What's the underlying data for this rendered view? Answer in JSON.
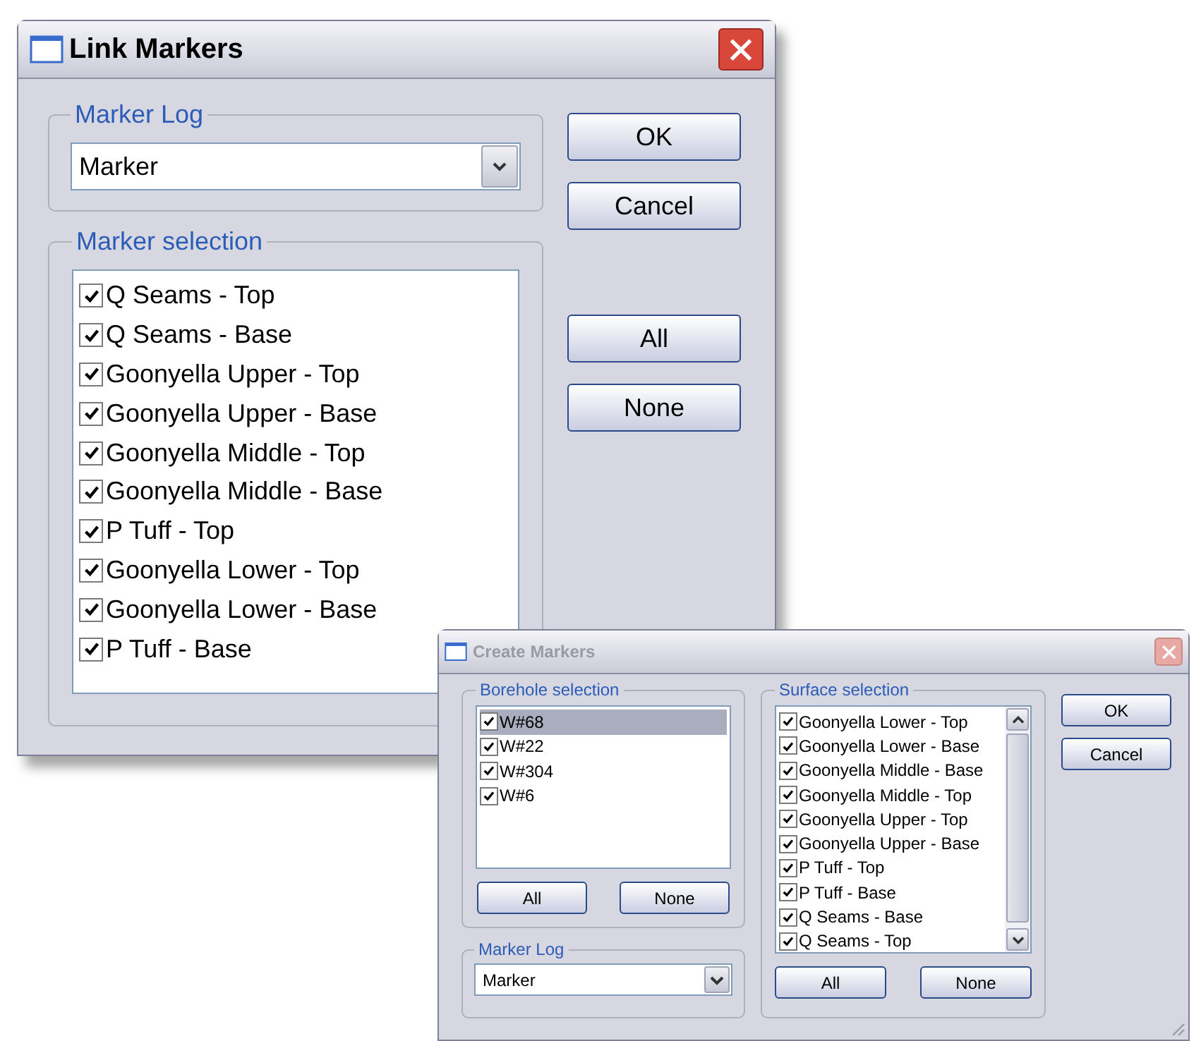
{
  "link_markers": {
    "title": "Link Markers",
    "active": true,
    "marker_log": {
      "label": "Marker Log",
      "value": "Marker"
    },
    "marker_selection": {
      "label": "Marker selection",
      "items": [
        {
          "label": "Q Seams - Top",
          "checked": true
        },
        {
          "label": "Q Seams - Base",
          "checked": true
        },
        {
          "label": "Goonyella Upper - Top",
          "checked": true
        },
        {
          "label": "Goonyella Upper - Base",
          "checked": true
        },
        {
          "label": "Goonyella Middle - Top",
          "checked": true
        },
        {
          "label": "Goonyella Middle - Base",
          "checked": true
        },
        {
          "label": "P Tuff - Top",
          "checked": true
        },
        {
          "label": "Goonyella Lower - Top",
          "checked": true
        },
        {
          "label": "Goonyella Lower - Base",
          "checked": true
        },
        {
          "label": "P Tuff - Base",
          "checked": true
        }
      ]
    },
    "buttons": [
      "OK",
      "Cancel"
    ],
    "selection_buttons": [
      "All",
      "None"
    ]
  },
  "create_markers": {
    "title": "Create Markers",
    "active": false,
    "borehole_selection": {
      "label": "Borehole selection",
      "items": [
        {
          "label": "W#68",
          "checked": true,
          "selected": true
        },
        {
          "label": "W#22",
          "checked": true,
          "selected": false
        },
        {
          "label": "W#304",
          "checked": true,
          "selected": false
        },
        {
          "label": "W#6",
          "checked": true,
          "selected": false
        }
      ],
      "buttons": [
        "All",
        "None"
      ]
    },
    "marker_log": {
      "label": "Marker Log",
      "value": "Marker"
    },
    "surface_selection": {
      "label": "Surface selection",
      "items": [
        {
          "label": "Goonyella Lower - Top",
          "checked": true
        },
        {
          "label": "Goonyella Lower - Base",
          "checked": true
        },
        {
          "label": "Goonyella Middle - Base",
          "checked": true
        },
        {
          "label": "Goonyella Middle - Top",
          "checked": true
        },
        {
          "label": "Goonyella Upper - Top",
          "checked": true
        },
        {
          "label": "Goonyella Upper - Base",
          "checked": true
        },
        {
          "label": "P Tuff - Top",
          "checked": true
        },
        {
          "label": "P Tuff - Base",
          "checked": true
        },
        {
          "label": "Q Seams - Base",
          "checked": true
        },
        {
          "label": "Q Seams - Top",
          "checked": true
        }
      ],
      "buttons": [
        "All",
        "None"
      ]
    },
    "buttons": [
      "OK",
      "Cancel"
    ]
  }
}
